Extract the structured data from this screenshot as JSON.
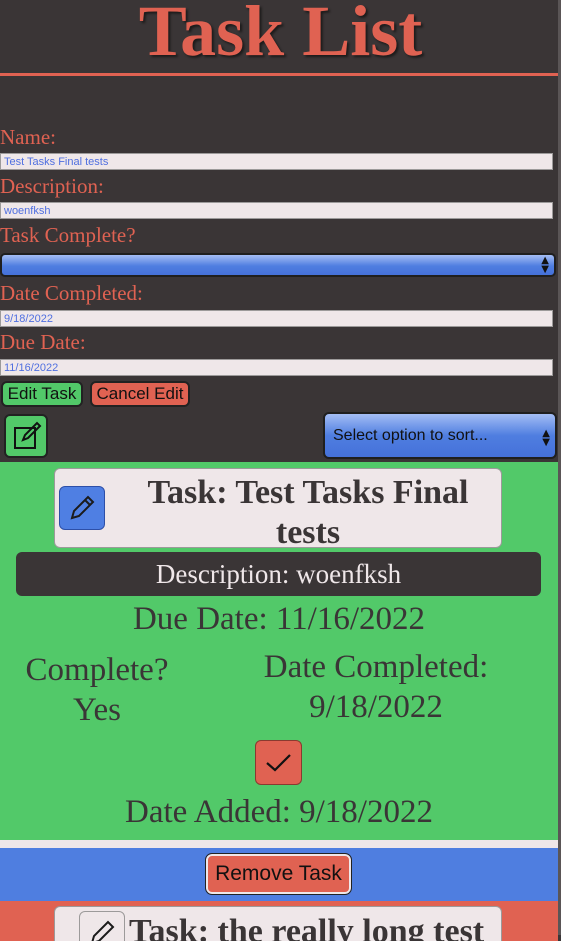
{
  "header": {
    "title": "Task List"
  },
  "form": {
    "name_label": "Name:",
    "name_value": "Test Tasks Final tests",
    "description_label": "Description:",
    "description_value": "woenfksh",
    "complete_label": "Task Complete?",
    "complete_value": "",
    "date_completed_label": "Date Completed:",
    "date_completed_value": "9/18/2022",
    "due_date_label": "Due Date:",
    "due_date_value": "11/16/2022",
    "edit_button": "Edit Task",
    "cancel_button": "Cancel Edit"
  },
  "toolbar": {
    "new_task_icon": "edit-square-icon",
    "sort_placeholder": "Select option to sort..."
  },
  "task_card": {
    "title": "Task: Test Tasks Final tests",
    "description": "Description: woenfksh",
    "due_date": "Due Date: 11/16/2022",
    "complete_label": "Complete?",
    "complete_value": "Yes",
    "date_completed_label": "Date Completed:",
    "date_completed_value": "9/18/2022",
    "date_added": "Date Added: 9/18/2022",
    "remove_button": "Remove Task",
    "colors": {
      "card": "#52c969",
      "remove_band": "#4f7ee0",
      "check_button": "#e06252"
    }
  },
  "next_task": {
    "title": "Task: the really long test"
  },
  "colors": {
    "background": "#3a3536",
    "accent": "#e06252",
    "input_bg": "#efe7e9",
    "text_blue": "#4f6fe0"
  }
}
